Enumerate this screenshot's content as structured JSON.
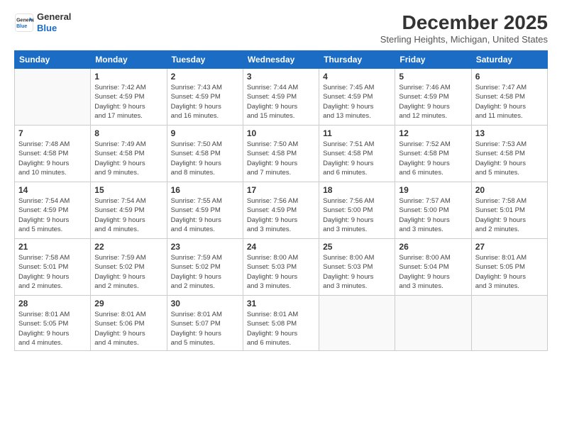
{
  "logo": {
    "line1": "General",
    "line2": "Blue"
  },
  "title": "December 2025",
  "location": "Sterling Heights, Michigan, United States",
  "days_header": [
    "Sunday",
    "Monday",
    "Tuesday",
    "Wednesday",
    "Thursday",
    "Friday",
    "Saturday"
  ],
  "weeks": [
    [
      {
        "num": "",
        "info": ""
      },
      {
        "num": "1",
        "info": "Sunrise: 7:42 AM\nSunset: 4:59 PM\nDaylight: 9 hours\nand 17 minutes."
      },
      {
        "num": "2",
        "info": "Sunrise: 7:43 AM\nSunset: 4:59 PM\nDaylight: 9 hours\nand 16 minutes."
      },
      {
        "num": "3",
        "info": "Sunrise: 7:44 AM\nSunset: 4:59 PM\nDaylight: 9 hours\nand 15 minutes."
      },
      {
        "num": "4",
        "info": "Sunrise: 7:45 AM\nSunset: 4:59 PM\nDaylight: 9 hours\nand 13 minutes."
      },
      {
        "num": "5",
        "info": "Sunrise: 7:46 AM\nSunset: 4:59 PM\nDaylight: 9 hours\nand 12 minutes."
      },
      {
        "num": "6",
        "info": "Sunrise: 7:47 AM\nSunset: 4:58 PM\nDaylight: 9 hours\nand 11 minutes."
      }
    ],
    [
      {
        "num": "7",
        "info": "Sunrise: 7:48 AM\nSunset: 4:58 PM\nDaylight: 9 hours\nand 10 minutes."
      },
      {
        "num": "8",
        "info": "Sunrise: 7:49 AM\nSunset: 4:58 PM\nDaylight: 9 hours\nand 9 minutes."
      },
      {
        "num": "9",
        "info": "Sunrise: 7:50 AM\nSunset: 4:58 PM\nDaylight: 9 hours\nand 8 minutes."
      },
      {
        "num": "10",
        "info": "Sunrise: 7:50 AM\nSunset: 4:58 PM\nDaylight: 9 hours\nand 7 minutes."
      },
      {
        "num": "11",
        "info": "Sunrise: 7:51 AM\nSunset: 4:58 PM\nDaylight: 9 hours\nand 6 minutes."
      },
      {
        "num": "12",
        "info": "Sunrise: 7:52 AM\nSunset: 4:58 PM\nDaylight: 9 hours\nand 6 minutes."
      },
      {
        "num": "13",
        "info": "Sunrise: 7:53 AM\nSunset: 4:58 PM\nDaylight: 9 hours\nand 5 minutes."
      }
    ],
    [
      {
        "num": "14",
        "info": "Sunrise: 7:54 AM\nSunset: 4:59 PM\nDaylight: 9 hours\nand 5 minutes."
      },
      {
        "num": "15",
        "info": "Sunrise: 7:54 AM\nSunset: 4:59 PM\nDaylight: 9 hours\nand 4 minutes."
      },
      {
        "num": "16",
        "info": "Sunrise: 7:55 AM\nSunset: 4:59 PM\nDaylight: 9 hours\nand 4 minutes."
      },
      {
        "num": "17",
        "info": "Sunrise: 7:56 AM\nSunset: 4:59 PM\nDaylight: 9 hours\nand 3 minutes."
      },
      {
        "num": "18",
        "info": "Sunrise: 7:56 AM\nSunset: 5:00 PM\nDaylight: 9 hours\nand 3 minutes."
      },
      {
        "num": "19",
        "info": "Sunrise: 7:57 AM\nSunset: 5:00 PM\nDaylight: 9 hours\nand 3 minutes."
      },
      {
        "num": "20",
        "info": "Sunrise: 7:58 AM\nSunset: 5:01 PM\nDaylight: 9 hours\nand 2 minutes."
      }
    ],
    [
      {
        "num": "21",
        "info": "Sunrise: 7:58 AM\nSunset: 5:01 PM\nDaylight: 9 hours\nand 2 minutes."
      },
      {
        "num": "22",
        "info": "Sunrise: 7:59 AM\nSunset: 5:02 PM\nDaylight: 9 hours\nand 2 minutes."
      },
      {
        "num": "23",
        "info": "Sunrise: 7:59 AM\nSunset: 5:02 PM\nDaylight: 9 hours\nand 2 minutes."
      },
      {
        "num": "24",
        "info": "Sunrise: 8:00 AM\nSunset: 5:03 PM\nDaylight: 9 hours\nand 3 minutes."
      },
      {
        "num": "25",
        "info": "Sunrise: 8:00 AM\nSunset: 5:03 PM\nDaylight: 9 hours\nand 3 minutes."
      },
      {
        "num": "26",
        "info": "Sunrise: 8:00 AM\nSunset: 5:04 PM\nDaylight: 9 hours\nand 3 minutes."
      },
      {
        "num": "27",
        "info": "Sunrise: 8:01 AM\nSunset: 5:05 PM\nDaylight: 9 hours\nand 3 minutes."
      }
    ],
    [
      {
        "num": "28",
        "info": "Sunrise: 8:01 AM\nSunset: 5:05 PM\nDaylight: 9 hours\nand 4 minutes."
      },
      {
        "num": "29",
        "info": "Sunrise: 8:01 AM\nSunset: 5:06 PM\nDaylight: 9 hours\nand 4 minutes."
      },
      {
        "num": "30",
        "info": "Sunrise: 8:01 AM\nSunset: 5:07 PM\nDaylight: 9 hours\nand 5 minutes."
      },
      {
        "num": "31",
        "info": "Sunrise: 8:01 AM\nSunset: 5:08 PM\nDaylight: 9 hours\nand 6 minutes."
      },
      {
        "num": "",
        "info": ""
      },
      {
        "num": "",
        "info": ""
      },
      {
        "num": "",
        "info": ""
      }
    ]
  ]
}
